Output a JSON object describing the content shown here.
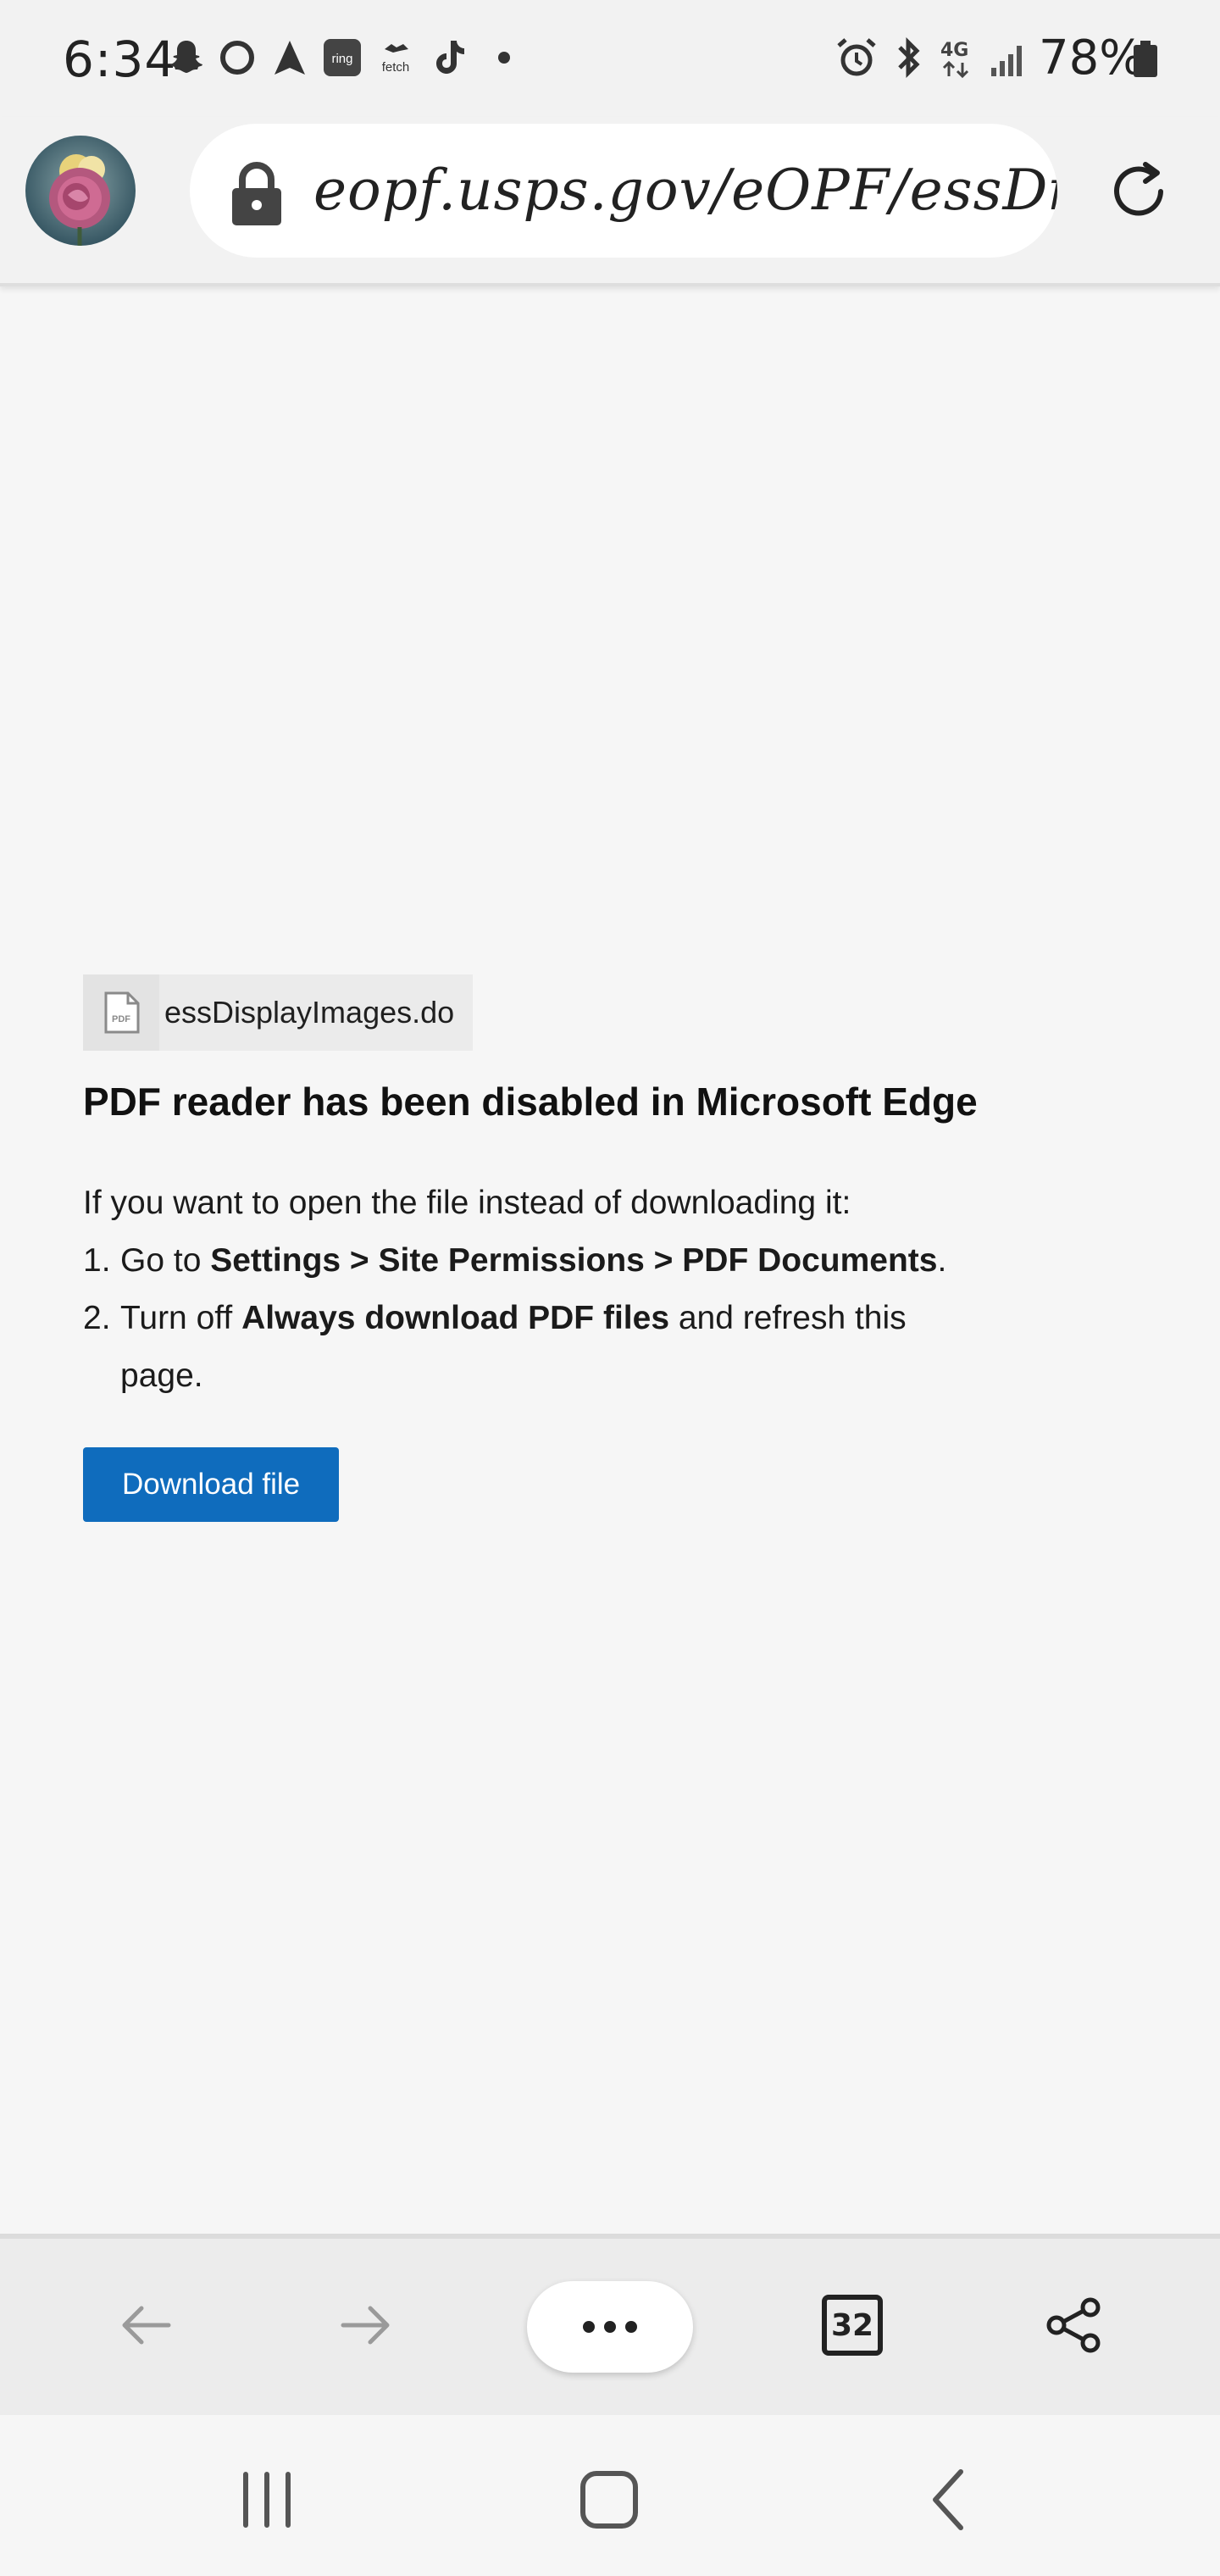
{
  "status_bar": {
    "time": "6:34",
    "battery": "78%",
    "icons": [
      "snapchat-icon",
      "circle-app-icon",
      "navigation-icon",
      "ring-icon",
      "fetch-icon",
      "tiktok-icon",
      "notification-dot-icon",
      "alarm-icon",
      "bluetooth-icon",
      "4g-lte-icon",
      "signal-icon",
      "battery-icon"
    ],
    "ring_label": "ring",
    "fetch_label": "fetch",
    "network_label": "4G"
  },
  "address_bar": {
    "url": "eopf.usps.gov/eOPF/essDisplayImages.do"
  },
  "content": {
    "file_icon_label": "PDF",
    "file_name": "essDisplayImages.do",
    "heading": "PDF reader has been disabled in Microsoft Edge",
    "intro": "If you want to open the file instead of downloading it:",
    "step1": {
      "num": "1.",
      "pre": "Go to ",
      "bold": "Settings > Site Permissions > PDF Documents",
      "post": "."
    },
    "step2": {
      "num": "2.",
      "pre": "Turn off ",
      "bold": "Always download PDF files",
      "post": " and refresh this page."
    },
    "download_label": "Download file"
  },
  "toolbar": {
    "tab_count": "32",
    "accent_color": "#0f6cbd"
  }
}
